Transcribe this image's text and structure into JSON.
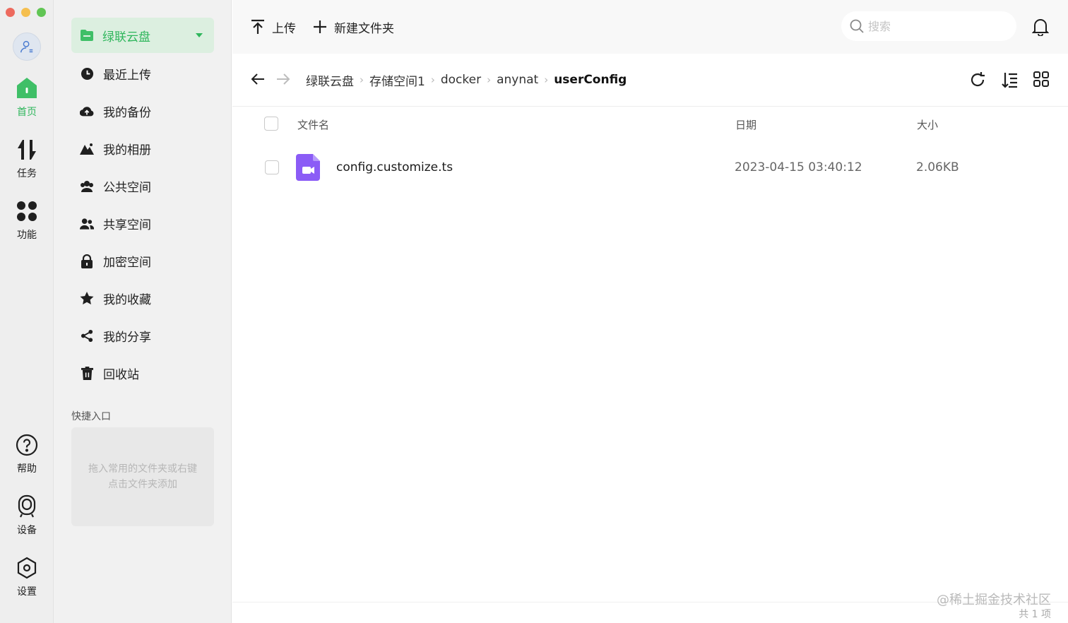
{
  "colors": {
    "accent": "#2fb65c",
    "accent_bg": "#dcefe0",
    "traffic_red": "#ed6a5e",
    "traffic_yellow": "#f5bf4f",
    "traffic_green": "#61c554",
    "file_icon": "#8b5cf6"
  },
  "rail": {
    "items": [
      {
        "label": "首页",
        "icon": "home-icon"
      },
      {
        "label": "任务",
        "icon": "transfer-icon"
      },
      {
        "label": "功能",
        "icon": "apps-icon"
      }
    ],
    "bottom": [
      {
        "label": "帮助",
        "icon": "help-icon"
      },
      {
        "label": "设备",
        "icon": "device-icon"
      },
      {
        "label": "设置",
        "icon": "settings-icon"
      }
    ]
  },
  "sidebar": {
    "cloud_label": "绿联云盘",
    "items": [
      {
        "label": "最近上传",
        "icon": "clock-icon"
      },
      {
        "label": "我的备份",
        "icon": "cloud-upload-icon"
      },
      {
        "label": "我的相册",
        "icon": "mountain-icon"
      },
      {
        "label": "公共空间",
        "icon": "group-icon"
      },
      {
        "label": "共享空间",
        "icon": "users-icon"
      },
      {
        "label": "加密空间",
        "icon": "lock-icon"
      },
      {
        "label": "我的收藏",
        "icon": "star-icon"
      },
      {
        "label": "我的分享",
        "icon": "share-icon"
      },
      {
        "label": "回收站",
        "icon": "trash-icon"
      }
    ],
    "quick_title": "快捷入口",
    "quick_hint": "拖入常用的文件夹或右键点击文件夹添加"
  },
  "toolbar": {
    "upload_label": "上传",
    "new_folder_label": "新建文件夹",
    "search_placeholder": "搜索"
  },
  "breadcrumb": [
    "绿联云盘",
    "存储空间1",
    "docker",
    "anynat",
    "userConfig"
  ],
  "table": {
    "headers": {
      "name": "文件名",
      "date": "日期",
      "size": "大小"
    },
    "rows": [
      {
        "name": "config.customize.ts",
        "date": "2023-04-15 03:40:12",
        "size": "2.06KB"
      }
    ]
  },
  "footer": {
    "watermark": "@稀土掘金技术社区",
    "count": "共 1 项"
  }
}
